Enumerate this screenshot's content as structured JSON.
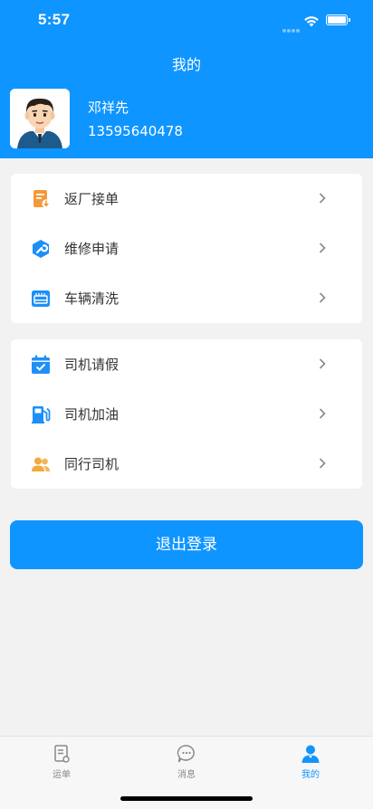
{
  "status_bar": {
    "time": "5:57"
  },
  "header": {
    "title": "我的"
  },
  "profile": {
    "name": "邓祥先",
    "phone": "13595640478"
  },
  "menu_group_1": [
    {
      "label": "返厂接单",
      "icon": "document-download-icon",
      "color": "#f5993a"
    },
    {
      "label": "维修申请",
      "icon": "wrench-icon",
      "color": "#1e8ff7"
    },
    {
      "label": "车辆清洗",
      "icon": "car-wash-icon",
      "color": "#1e8ff7"
    }
  ],
  "menu_group_2": [
    {
      "label": "司机请假",
      "icon": "calendar-check-icon",
      "color": "#1e8ff7"
    },
    {
      "label": "司机加油",
      "icon": "fuel-pump-icon",
      "color": "#1e8ff7"
    },
    {
      "label": "同行司机",
      "icon": "users-icon",
      "color": "#f3a93b"
    }
  ],
  "logout_label": "退出登录",
  "tabs": [
    {
      "label": "运单",
      "icon": "waybill-icon",
      "active": false
    },
    {
      "label": "消息",
      "icon": "chat-bubble-icon",
      "active": false
    },
    {
      "label": "我的",
      "icon": "user-icon",
      "active": true
    }
  ],
  "colors": {
    "primary": "#0f95ff",
    "background": "#f2f2f2"
  }
}
